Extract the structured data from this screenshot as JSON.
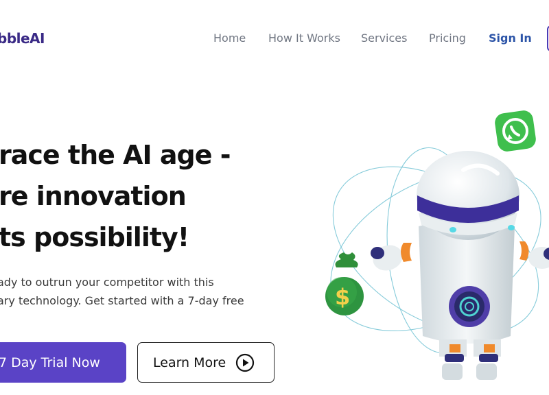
{
  "header": {
    "logo_text": "bbleAI",
    "nav": [
      {
        "label": "Home"
      },
      {
        "label": "How It Works"
      },
      {
        "label": "Services"
      },
      {
        "label": "Pricing"
      },
      {
        "label": "Sign In"
      }
    ]
  },
  "hero": {
    "title_lines": [
      "race the AI age -",
      "re innovation",
      "ts possibility!"
    ],
    "description_lines": [
      "ady to outrun your competitor with this",
      "ary technology. Get started with a 7-day free"
    ],
    "primary_button": "7 Day Trial Now",
    "secondary_button": "Learn More"
  },
  "colors": {
    "brand": "#5a43c6",
    "logo": "#3a2a86",
    "nav_text": "#707682",
    "sign_in": "#2d55a8"
  }
}
